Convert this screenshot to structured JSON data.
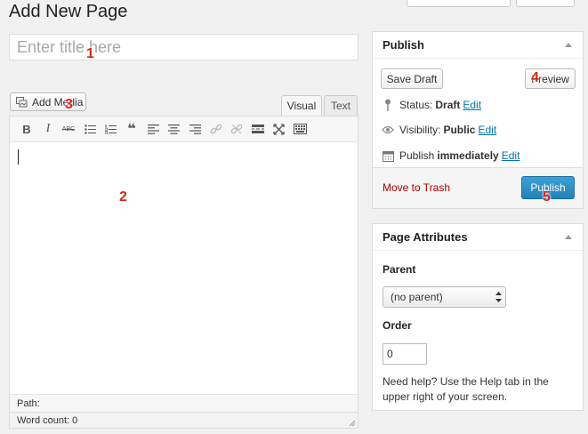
{
  "page_title": "Add New Page",
  "title_field": {
    "placeholder": "Enter title here",
    "value": ""
  },
  "media_button": {
    "label": "Add Media"
  },
  "editor_tabs": [
    "Visual",
    "Text"
  ],
  "toolbar_icons": [
    "bold-icon",
    "italic-icon",
    "strikethrough-icon",
    "bullet-list-icon",
    "numbered-list-icon",
    "blockquote-icon",
    "align-left-icon",
    "align-center-icon",
    "align-right-icon",
    "insert-link-icon",
    "unlink-icon",
    "read-more-icon",
    "fullscreen-icon",
    "toolbar-toggle-icon"
  ],
  "toolbar_glyphs": {
    "bold": "B",
    "italic": "I",
    "strikethrough": "ABC",
    "blockquote": "❝"
  },
  "path_label": "Path:",
  "word_count": "Word count: 0",
  "publish_box": {
    "title": "Publish",
    "save_draft": "Save Draft",
    "preview": "Preview",
    "status_label": "Status:",
    "status_value": "Draft",
    "visibility_label": "Visibility:",
    "visibility_value": "Public",
    "publish_label": "Publish",
    "publish_value": "immediately",
    "edit": "Edit",
    "move_to_trash": "Move to Trash",
    "publish_button": "Publish"
  },
  "attributes_box": {
    "title": "Page Attributes",
    "parent_label": "Parent",
    "parent_selected": "(no parent)",
    "order_label": "Order",
    "order_value": "0",
    "help_text": "Need help? Use the Help tab in the upper right of your screen."
  },
  "callouts": [
    "1",
    "2",
    "3",
    "4",
    "5"
  ],
  "colors": {
    "accent_link": "#0073aa",
    "publish_button": "#2a8fc7",
    "trash_link": "#aa0000",
    "callout": "#d12a1d"
  }
}
